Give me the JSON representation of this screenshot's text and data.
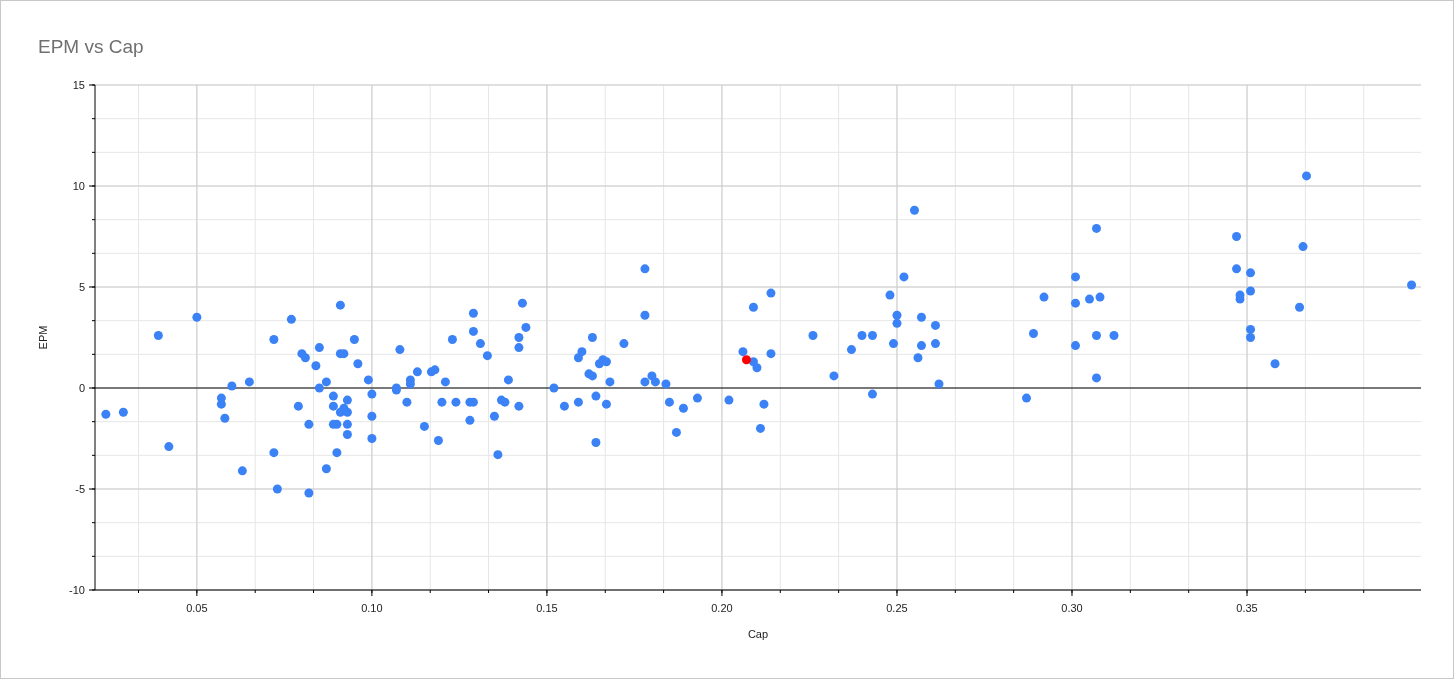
{
  "chart": {
    "chart_data": {
      "type": "scatter",
      "title": "EPM vs Cap",
      "xlabel": "Cap",
      "ylabel": "EPM",
      "xlim": [
        0.0209,
        0.3997
      ],
      "ylim": [
        -10,
        15
      ],
      "xticks": [
        {
          "value": 0.05,
          "label": "0.05"
        },
        {
          "value": 0.1,
          "label": "0.10"
        },
        {
          "value": 0.15,
          "label": "0.15"
        },
        {
          "value": 0.2,
          "label": "0.20"
        },
        {
          "value": 0.25,
          "label": "0.25"
        },
        {
          "value": 0.3,
          "label": "0.30"
        },
        {
          "value": 0.35,
          "label": "0.35"
        }
      ],
      "yticks": [
        -10,
        -5,
        0,
        5,
        10,
        15
      ],
      "grid": true,
      "x": [
        0.207,
        0.024,
        0.029,
        0.039,
        0.042,
        0.05,
        0.057,
        0.057,
        0.058,
        0.06,
        0.065,
        0.063,
        0.072,
        0.072,
        0.073,
        0.077,
        0.079,
        0.08,
        0.081,
        0.082,
        0.082,
        0.084,
        0.085,
        0.085,
        0.087,
        0.087,
        0.089,
        0.089,
        0.089,
        0.09,
        0.09,
        0.091,
        0.091,
        0.091,
        0.092,
        0.093,
        0.093,
        0.093,
        0.093,
        0.092,
        0.095,
        0.096,
        0.099,
        0.1,
        0.1,
        0.1,
        0.107,
        0.107,
        0.108,
        0.11,
        0.111,
        0.111,
        0.113,
        0.115,
        0.117,
        0.118,
        0.12,
        0.119,
        0.121,
        0.123,
        0.124,
        0.128,
        0.129,
        0.129,
        0.129,
        0.128,
        0.131,
        0.133,
        0.135,
        0.136,
        0.137,
        0.138,
        0.139,
        0.142,
        0.142,
        0.142,
        0.143,
        0.144,
        0.152,
        0.155,
        0.159,
        0.159,
        0.16,
        0.163,
        0.162,
        0.163,
        0.164,
        0.164,
        0.165,
        0.166,
        0.167,
        0.167,
        0.168,
        0.172,
        0.178,
        0.178,
        0.178,
        0.18,
        0.181,
        0.184,
        0.185,
        0.187,
        0.189,
        0.193,
        0.202,
        0.206,
        0.209,
        0.209,
        0.21,
        0.211,
        0.212,
        0.214,
        0.214,
        0.226,
        0.232,
        0.237,
        0.24,
        0.243,
        0.243,
        0.248,
        0.249,
        0.25,
        0.25,
        0.252,
        0.255,
        0.256,
        0.257,
        0.257,
        0.261,
        0.261,
        0.262,
        0.287,
        0.289,
        0.292,
        0.301,
        0.301,
        0.301,
        0.305,
        0.307,
        0.307,
        0.307,
        0.308,
        0.312,
        0.347,
        0.347,
        0.348,
        0.348,
        0.351,
        0.351,
        0.351,
        0.351,
        0.358,
        0.365,
        0.366,
        0.367,
        0.397
      ],
      "series": [
        {
          "color": "#3b82f6",
          "values": [
            null,
            -1.3,
            -1.2,
            2.6,
            -2.9,
            3.5,
            -0.5,
            -0.8,
            -1.5,
            0.1,
            0.3,
            -4.1,
            2.4,
            -3.2,
            -5.0,
            3.4,
            -0.9,
            1.7,
            1.5,
            -1.8,
            -5.2,
            1.1,
            2.0,
            0.0,
            0.3,
            -4.0,
            -0.9,
            -1.8,
            -0.4,
            -1.8,
            -3.2,
            4.1,
            1.7,
            -1.2,
            1.7,
            -0.6,
            -1.8,
            -1.2,
            -2.3,
            -1.0,
            2.4,
            1.2,
            0.4,
            -0.3,
            -1.4,
            -2.5,
            -0.1,
            0.0,
            1.9,
            -0.7,
            0.4,
            0.2,
            0.8,
            -1.9,
            0.8,
            0.9,
            -0.7,
            -2.6,
            0.3,
            2.4,
            -0.7,
            -0.7,
            3.7,
            2.8,
            -0.7,
            -1.6,
            2.2,
            1.6,
            -1.4,
            -3.3,
            -0.6,
            -0.7,
            0.4,
            2.5,
            2.0,
            -0.9,
            4.2,
            3.0,
            0.0,
            -0.9,
            1.5,
            -0.7,
            1.8,
            2.5,
            0.7,
            0.6,
            -0.4,
            -2.7,
            1.2,
            1.4,
            1.3,
            -0.8,
            0.3,
            2.2,
            5.9,
            0.3,
            3.6,
            0.6,
            0.3,
            0.2,
            -0.7,
            -2.2,
            -1.0,
            -0.5,
            -0.6,
            1.8,
            4.0,
            1.3,
            1.0,
            -2.0,
            -0.8,
            4.7,
            1.7,
            2.6,
            0.6,
            1.9,
            2.6,
            2.6,
            -0.3,
            4.6,
            2.2,
            3.6,
            3.2,
            5.5,
            8.8,
            1.5,
            3.5,
            2.1,
            3.1,
            2.2,
            0.2,
            -0.5,
            2.7,
            4.5,
            5.5,
            4.2,
            2.1,
            4.4,
            7.9,
            2.6,
            0.5,
            4.5,
            2.6,
            7.5,
            5.9,
            4.6,
            4.4,
            5.7,
            4.8,
            2.9,
            2.5,
            1.2,
            4.0,
            7.0,
            10.5,
            5.1
          ]
        },
        {
          "color": "#ff0000",
          "values": [
            1.4,
            null,
            null,
            null,
            null,
            null,
            null,
            null,
            null,
            null,
            null,
            null,
            null,
            null,
            null,
            null,
            null,
            null,
            null,
            null,
            null,
            null,
            null,
            null,
            null,
            null,
            null,
            null,
            null,
            null,
            null,
            null,
            null,
            null,
            null,
            null,
            null,
            null,
            null,
            null,
            null,
            null,
            null,
            null,
            null,
            null,
            null,
            null,
            null,
            null,
            null,
            null,
            null,
            null,
            null,
            null,
            null,
            null,
            null,
            null,
            null,
            null,
            null,
            null,
            null,
            null,
            null,
            null,
            null,
            null,
            null,
            null,
            null,
            null,
            null,
            null,
            null,
            null,
            null,
            null,
            null,
            null,
            null,
            null,
            null,
            null,
            null,
            null,
            null,
            null,
            null,
            null,
            null,
            null,
            null,
            null,
            null,
            null,
            null,
            null,
            null,
            null,
            null,
            null,
            null,
            null,
            null,
            null,
            null,
            null,
            null,
            null,
            null,
            null,
            null,
            null,
            null,
            null,
            null,
            null,
            null,
            null,
            null,
            null,
            null,
            null,
            null,
            null,
            null,
            null,
            null,
            null,
            null,
            null,
            null,
            null,
            null,
            null,
            null,
            null,
            null,
            null,
            null,
            null,
            null,
            null,
            null,
            null,
            null,
            null,
            null,
            null,
            null,
            null,
            null,
            null
          ]
        }
      ]
    }
  }
}
